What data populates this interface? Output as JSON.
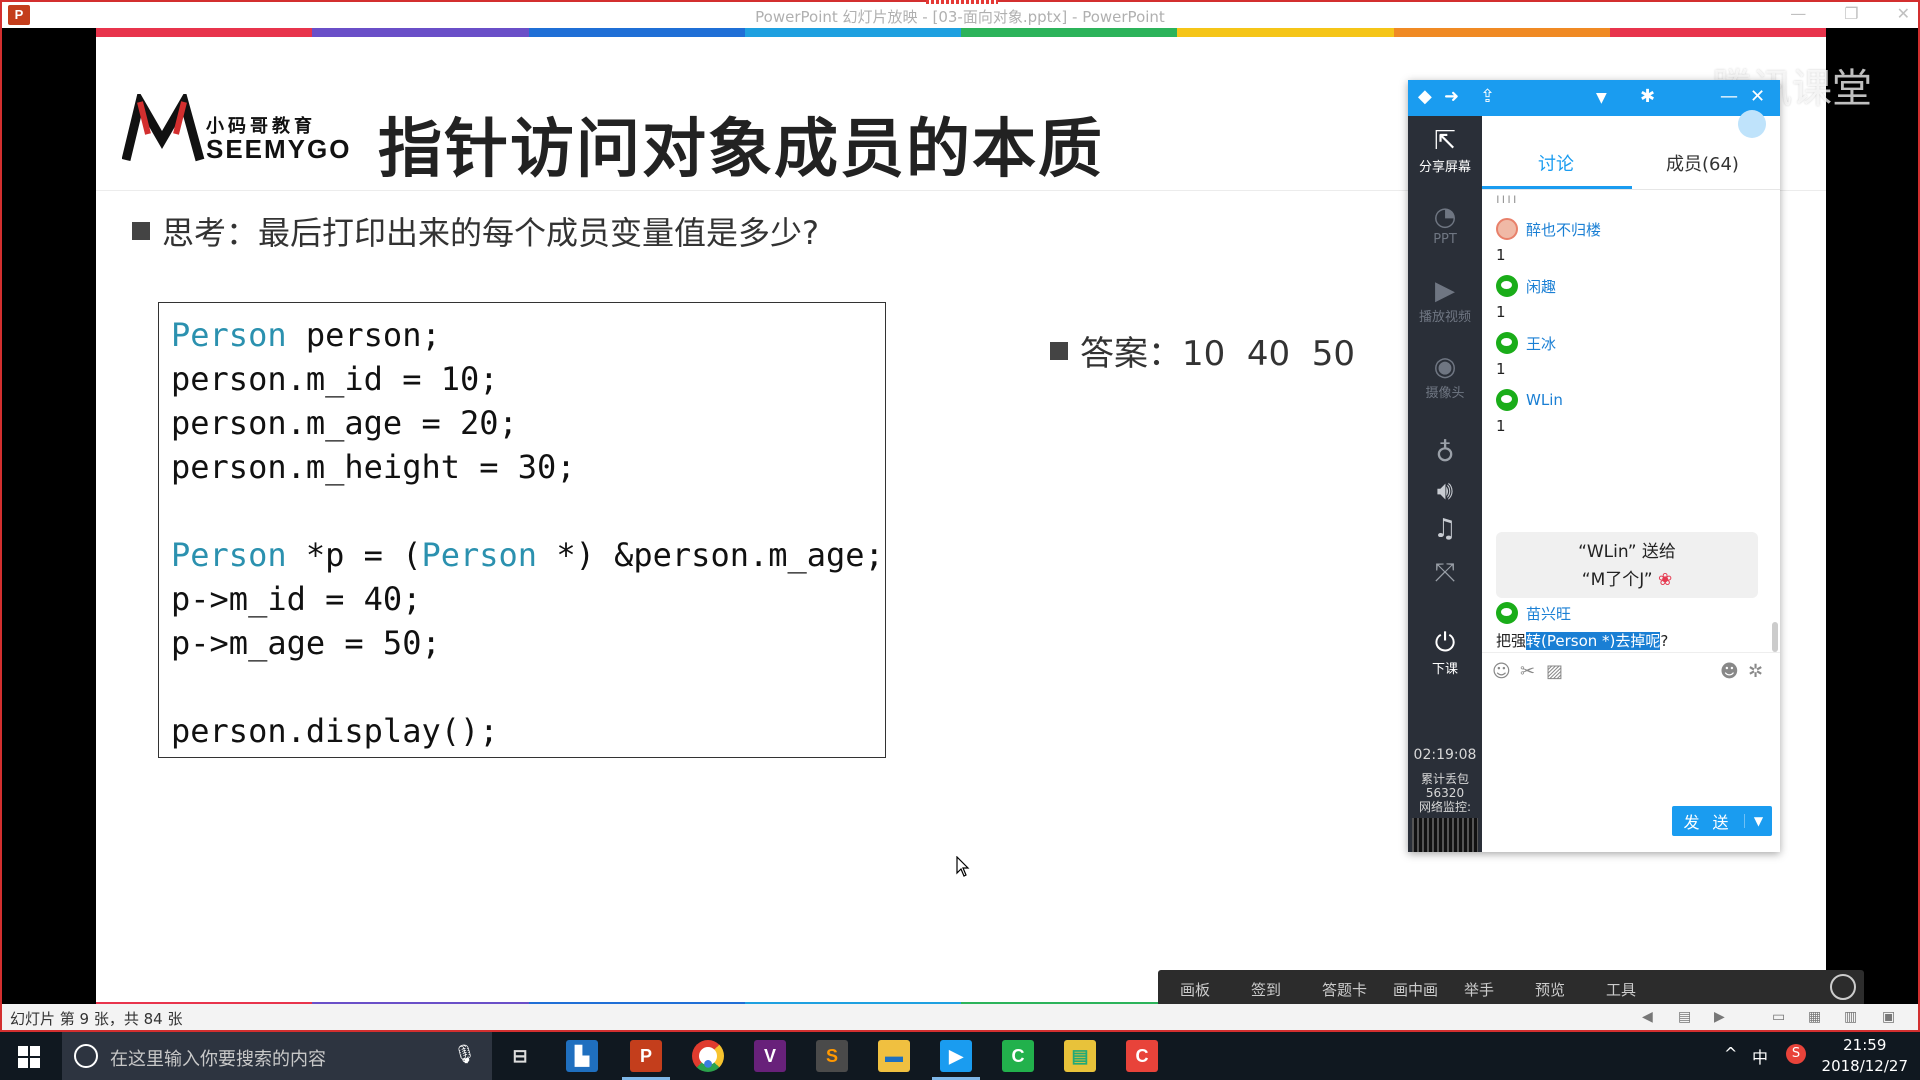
{
  "window": {
    "app_icon": "P",
    "title": "PowerPoint 幻灯片放映 - [03-面向对象.pptx] - PowerPoint"
  },
  "slide": {
    "logo_cn": "小码哥教育",
    "logo_en": "SEEMYGO",
    "title": "指针访问对象成员的本质",
    "question": "思考：最后打印出来的每个成员变量值是多少?",
    "code_lines": [
      {
        "kw": "Person",
        "rest": " person;"
      },
      {
        "kw": "",
        "rest": "person.m_id = 10;"
      },
      {
        "kw": "",
        "rest": "person.m_age = 20;"
      },
      {
        "kw": "",
        "rest": "person.m_height = 30;"
      },
      {
        "kw": "",
        "rest": ""
      },
      {
        "kw": "Person",
        "rest": " *p = (",
        "kw2": "Person",
        "rest2": " *) &person.m_age;"
      },
      {
        "kw": "",
        "rest": "p->m_id = 40;"
      },
      {
        "kw": "",
        "rest": "p->m_age = 50;"
      },
      {
        "kw": "",
        "rest": ""
      },
      {
        "kw": "",
        "rest": "person.display();"
      }
    ],
    "answer": "答案：10  40  50",
    "rainbow_colors": [
      "#e8344c",
      "#6a4fc8",
      "#1f6fd6",
      "#1ea0e0",
      "#2cb35a",
      "#f5c518",
      "#f08a24",
      "#e8344c"
    ]
  },
  "panel": {
    "side": {
      "share_screen": "分享屏幕",
      "ppt": "PPT",
      "play_video": "播放视频",
      "camera": "摄像头",
      "end_class": "下课",
      "timer": "02:19:08",
      "loss_label": "累计丢包",
      "loss_value": "56320",
      "net_label": "网络监控:"
    },
    "tabs": {
      "discuss": "讨论",
      "members": "成员(64)"
    },
    "messages": [
      {
        "user": "醉也不归楼",
        "text": "1",
        "avatar": "photo"
      },
      {
        "user": "闲趣",
        "text": "1",
        "avatar": "wechat"
      },
      {
        "user": "王冰",
        "text": "1",
        "avatar": "wechat"
      },
      {
        "user": "WLin",
        "text": "1",
        "avatar": "wechat"
      }
    ],
    "gift_line1": "“WLin” 送给",
    "gift_line2": "“M了个J”",
    "last_user": "苗兴旺",
    "last_text_pre": "把强",
    "last_text_hl": "转(Person *)去掉呢",
    "last_text_post": "?",
    "send_label": "发 送"
  },
  "watermark": "腾讯课堂",
  "teach_bar": [
    "画板",
    "签到",
    "答题卡",
    "画中画",
    "举手",
    "预览",
    "工具"
  ],
  "status": {
    "slide_info": "幻灯片 第 9 张，共 84 张"
  },
  "taskbar": {
    "search_placeholder": "在这里输入你要搜索的内容",
    "ime": "中",
    "time": "21:59",
    "date": "2018/12/27"
  }
}
